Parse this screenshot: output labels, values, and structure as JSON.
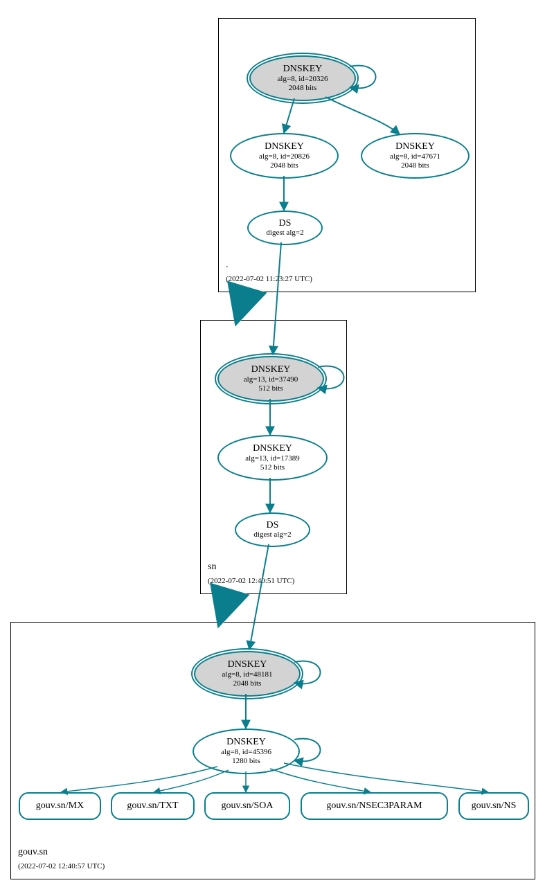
{
  "zones": {
    "root": {
      "name": ".",
      "timestamp": "(2022-07-02 11:23:27 UTC)"
    },
    "sn": {
      "name": "sn",
      "timestamp": "(2022-07-02 12:40:51 UTC)"
    },
    "gouv": {
      "name": "gouv.sn",
      "timestamp": "(2022-07-02 12:40:57 UTC)"
    }
  },
  "nodes": {
    "root_ksk": {
      "title": "DNSKEY",
      "line2": "alg=8, id=20326",
      "line3": "2048 bits"
    },
    "root_zsk1": {
      "title": "DNSKEY",
      "line2": "alg=8, id=20826",
      "line3": "2048 bits"
    },
    "root_zsk2": {
      "title": "DNSKEY",
      "line2": "alg=8, id=47671",
      "line3": "2048 bits"
    },
    "root_ds": {
      "title": "DS",
      "line2": "digest alg=2"
    },
    "sn_ksk": {
      "title": "DNSKEY",
      "line2": "alg=13, id=37490",
      "line3": "512 bits"
    },
    "sn_zsk": {
      "title": "DNSKEY",
      "line2": "alg=13, id=17389",
      "line3": "512 bits"
    },
    "sn_ds": {
      "title": "DS",
      "line2": "digest alg=2"
    },
    "gouv_ksk": {
      "title": "DNSKEY",
      "line2": "alg=8, id=48181",
      "line3": "2048 bits"
    },
    "gouv_zsk": {
      "title": "DNSKEY",
      "line2": "alg=8, id=45396",
      "line3": "1280 bits"
    },
    "rr_mx": {
      "label": "gouv.sn/MX"
    },
    "rr_txt": {
      "label": "gouv.sn/TXT"
    },
    "rr_soa": {
      "label": "gouv.sn/SOA"
    },
    "rr_nsec3": {
      "label": "gouv.sn/NSEC3PARAM"
    },
    "rr_ns": {
      "label": "gouv.sn/NS"
    }
  },
  "colors": {
    "stroke": "#0a7e8c",
    "shade": "#d3d3d3"
  }
}
